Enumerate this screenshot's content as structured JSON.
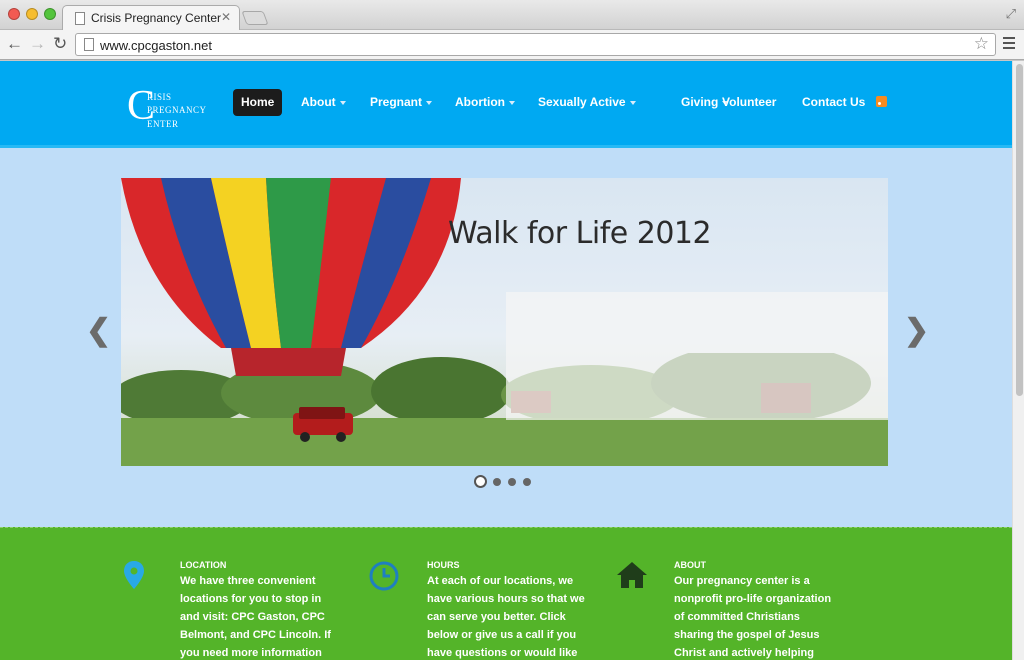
{
  "browser": {
    "tab_title": "Crisis Pregnancy Center",
    "url": "www.cpcgaston.net"
  },
  "logo": {
    "big_letter": "C",
    "line1": "RISIS",
    "line2": "PREGNANCY",
    "line3": "ENTER"
  },
  "nav": [
    {
      "label": "Home",
      "active": true
    },
    {
      "label": "About",
      "dropdown": true
    },
    {
      "label": "Pregnant",
      "dropdown": true
    },
    {
      "label": "Abortion",
      "dropdown": true
    },
    {
      "label": "Sexually Active",
      "dropdown": true
    },
    {
      "label": "Giving",
      "dropdown": true
    },
    {
      "label": "Volunteer"
    },
    {
      "label": "Contact Us"
    }
  ],
  "slider": {
    "caption": "Walk for Life 2012",
    "prev_label": "❮",
    "next_label": "❯",
    "slide_count": 4,
    "active_slide": 1
  },
  "info": {
    "location": {
      "heading": "LOCATION",
      "text": "We have three convenient locations for you to stop in and visit: CPC Gaston, CPC Belmont, and CPC Lincoln. If you need more information about who we are or"
    },
    "hours": {
      "heading": "HOURS",
      "text": "At each of our locations, we have various hours so that we can serve you better. Click below or give us a call if you have questions or would like to schedule an"
    },
    "about": {
      "heading": "ABOUT",
      "text": "Our pregnancy center is a nonprofit pro-life organization of committed Christians sharing the gospel of Jesus Christ and actively helping women, men and families"
    }
  },
  "colors": {
    "header": "#00a9f2",
    "page_bg": "#bfddf8",
    "green_band": "#54b429",
    "icon_blue": "#29a9e5",
    "icon_dark": "#1f3d1a"
  }
}
